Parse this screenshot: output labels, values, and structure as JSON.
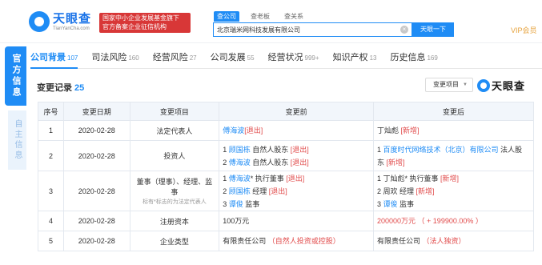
{
  "header": {
    "logo_title": "天眼查",
    "logo_sub": "TianYanCha.com",
    "gov_badge_line1": "国家中小企业发展基金旗下",
    "gov_badge_line2": "官方备案企业征信机构",
    "search_tabs": [
      "查公司",
      "查老板",
      "查关系"
    ],
    "search_value": "北京瑞米网科技发展有限公司",
    "search_button": "天眼一下",
    "vip": "VIP会员"
  },
  "side": {
    "tab1": "官方信息",
    "tab2": "自主信息"
  },
  "nav": {
    "items": [
      {
        "label": "公司背景",
        "count": "107"
      },
      {
        "label": "司法风险",
        "count": "160"
      },
      {
        "label": "经营风险",
        "count": "27"
      },
      {
        "label": "公司发展",
        "count": "55"
      },
      {
        "label": "经营状况",
        "count": "999+"
      },
      {
        "label": "知识产权",
        "count": "13"
      },
      {
        "label": "历史信息",
        "count": "169"
      }
    ]
  },
  "section": {
    "title": "变更记录",
    "count": "25",
    "dropdown": "变更项目",
    "brand": "天眼查"
  },
  "table": {
    "headers": [
      "序号",
      "变更日期",
      "变更项目",
      "变更前",
      "变更后"
    ],
    "rows": [
      {
        "no": "1",
        "date": "2020-02-28",
        "item": "法定代表人",
        "item_hint": "",
        "before": [
          {
            "pre": "",
            "link": "傅海波",
            "post": "",
            "tag": "[退出]"
          }
        ],
        "after": [
          {
            "pre": "",
            "link": "",
            "post": "丁灿彪 ",
            "tag": "[新增]"
          }
        ]
      },
      {
        "no": "2",
        "date": "2020-02-28",
        "item": "投资人",
        "item_hint": "",
        "before": [
          {
            "pre": "1 ",
            "link": "顾国栋",
            "post": " 自然人股东 ",
            "tag": "[退出]"
          },
          {
            "pre": "2 ",
            "link": "傅海波",
            "post": " 自然人股东 ",
            "tag": "[退出]"
          }
        ],
        "after": [
          {
            "pre": "1 ",
            "link": "百度时代网络技术（北京）有限公司",
            "post": " 法人股",
            "tag": ""
          },
          {
            "pre": "东 ",
            "link": "",
            "post": "",
            "tag": "[新增]"
          }
        ]
      },
      {
        "no": "3",
        "date": "2020-02-28",
        "item": "董事（理事）、经理、监事",
        "item_hint": "标有*标志的为法定代表人",
        "before": [
          {
            "pre": "1 ",
            "link": "傅海波",
            "post": "* 执行董事 ",
            "tag": "[退出]"
          },
          {
            "pre": "2 ",
            "link": "顾国栋",
            "post": " 经理 ",
            "tag": "[退出]"
          },
          {
            "pre": "3 ",
            "link": "谭俊",
            "post": " 监事",
            "tag": ""
          }
        ],
        "after": [
          {
            "pre": "1 ",
            "link": "",
            "post": "丁灿彪* 执行董事 ",
            "tag": "[新增]"
          },
          {
            "pre": "2 ",
            "link": "",
            "post": "周欢 经理 ",
            "tag": "[新增]"
          },
          {
            "pre": "3 ",
            "link": "谭俊",
            "post": " 监事",
            "tag": ""
          }
        ]
      },
      {
        "no": "4",
        "date": "2020-02-28",
        "item": "注册资本",
        "item_hint": "",
        "before": [
          {
            "pre": "",
            "link": "",
            "post": "100万元",
            "tag": ""
          }
        ],
        "after": [
          {
            "pre": "",
            "link": "",
            "post": "",
            "tag": "200000万元 （ + 199900.00% ）"
          }
        ]
      },
      {
        "no": "5",
        "date": "2020-02-28",
        "item": "企业类型",
        "item_hint": "",
        "before": [
          {
            "pre": "",
            "link": "",
            "post": "有限责任公司 ",
            "tag": "（自然人投资或控股）"
          }
        ],
        "after": [
          {
            "pre": "",
            "link": "",
            "post": "有限责任公司 ",
            "tag": "（法人独资）"
          }
        ]
      }
    ]
  },
  "colors": {
    "brand_blue": "#1f8cf5",
    "badge_red": "#d83737",
    "change_red": "#e14b4b",
    "vip_gold": "#e6a23c"
  }
}
